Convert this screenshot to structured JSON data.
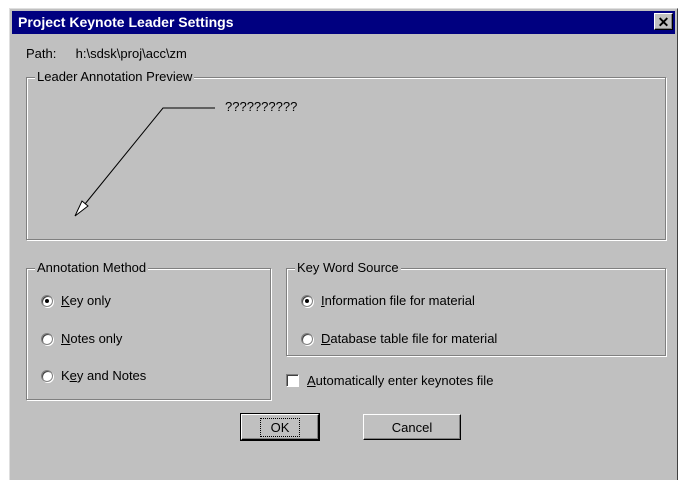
{
  "window": {
    "title": "Project Keynote Leader Settings",
    "close_glyph": "✕"
  },
  "path": {
    "label": "Path:",
    "value": "h:\\sdsk\\proj\\acc\\zm"
  },
  "preview": {
    "legend": "Leader Annotation Preview",
    "sample_text": "??????????"
  },
  "annotation_method": {
    "legend": "Annotation Method",
    "options": [
      {
        "pre": "",
        "key": "K",
        "post": "ey only",
        "selected": true
      },
      {
        "pre": "",
        "key": "N",
        "post": "otes only",
        "selected": false
      },
      {
        "pre": "K",
        "key": "e",
        "post": "y and Notes",
        "selected": false
      }
    ]
  },
  "key_word_source": {
    "legend": "Key Word Source",
    "options": [
      {
        "pre": "",
        "key": "I",
        "post": "nformation file for material",
        "selected": true
      },
      {
        "pre": "",
        "key": "D",
        "post": "atabase table file for material",
        "selected": false
      }
    ]
  },
  "auto_enter": {
    "pre": "",
    "key": "A",
    "post": "utomatically enter keynotes file",
    "checked": false
  },
  "buttons": {
    "ok": "OK",
    "cancel": "Cancel"
  }
}
